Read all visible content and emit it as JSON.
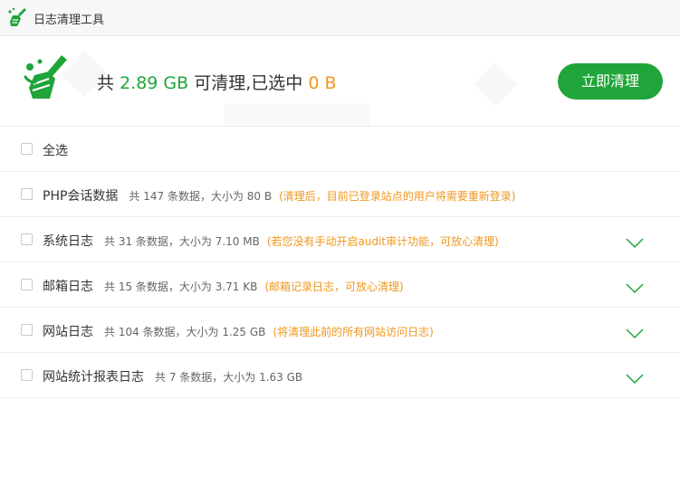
{
  "window": {
    "title": "日志清理工具",
    "logo_icon": "broom-logo-icon"
  },
  "header": {
    "prefix": "共",
    "total": "2.89 GB",
    "middle": "可清理,已选中",
    "selected": "0 B",
    "button_label": "立即清理",
    "accent_color": "#20a53a",
    "highlight_color": "#f0961b"
  },
  "select_all": {
    "label": "全选"
  },
  "items": [
    {
      "name": "PHP会话数据",
      "info": "共 147 条数据，大小为 80 B",
      "note": "(清理后，目前已登录站点的用户将需要重新登录)",
      "expandable": false
    },
    {
      "name": "系统日志",
      "info": "共 31 条数据，大小为 7.10 MB",
      "note": "(若您没有手动开启audit审计功能，可放心清理)",
      "expandable": true
    },
    {
      "name": "邮箱日志",
      "info": "共 15 条数据，大小为 3.71 KB",
      "note": "(邮箱记录日志，可放心清理)",
      "expandable": true
    },
    {
      "name": "网站日志",
      "info": "共 104 条数据，大小为 1.25 GB",
      "note": "(将清理此前的所有网站访问日志)",
      "expandable": true
    },
    {
      "name": "网站统计报表日志",
      "info": "共 7 条数据，大小为 1.63 GB",
      "note": "",
      "expandable": true
    }
  ]
}
